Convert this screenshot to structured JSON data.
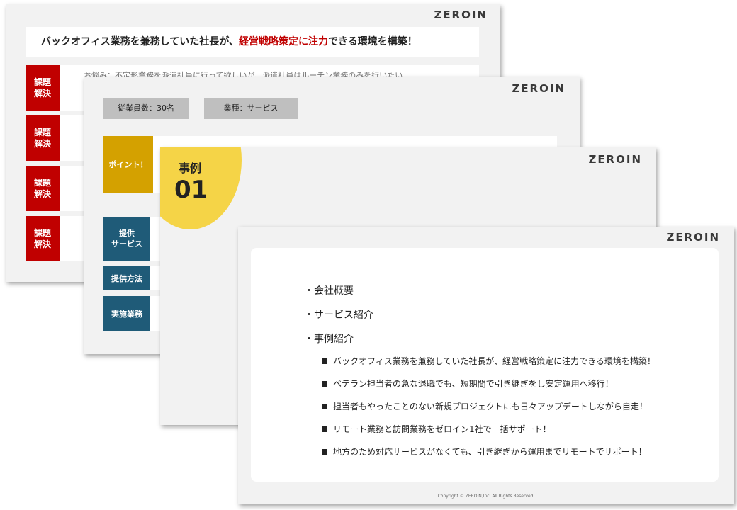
{
  "brand": "ZEROIN",
  "colors": {
    "accent_red": "#c00000",
    "accent_gold": "#d4a100",
    "accent_navy": "#1f5b78",
    "accent_yellow": "#f5d447"
  },
  "slide1": {
    "headline_pre": "バックオフィス業務を兼務していた社長が、",
    "headline_red": "経営戦略策定に注力",
    "headline_post": "できる環境を構築！",
    "issue_label_1": "課題",
    "issue_label_2": "解決",
    "partial_text": "お悩み：不定形業務を派遣社員に行って欲しいが、派遣社員はルーチン業務のみを行いたい"
  },
  "slide2": {
    "employees": "従業員数：30名",
    "industry": "業種：サービス",
    "point": "ポイント！",
    "service_1": "提供",
    "service_2": "サービス",
    "method": "提供方法",
    "work": "実施業務"
  },
  "slide3": {
    "case_label": "事例",
    "case_number": "01"
  },
  "slide4": {
    "main_items": [
      "・会社概要",
      "・サービス紹介",
      "・事例紹介"
    ],
    "sub_items": [
      "バックオフィス業務を兼務していた社長が、経営戦略策定に注力できる環境を構築！",
      "ベテラン担当者の急な退職でも、短期間で引き継ぎをし安定運用へ移行！",
      "担当者もやったことのない新規プロジェクトにも日々アップデートしながら自走！",
      "リモート業務と訪問業務をゼロイン1社で一括サポート！",
      "地方のため対応サービスがなくても、引き継ぎから運用までリモートでサポート！"
    ],
    "copyright": "Copyright © ZEROIN,Inc. All Rights Reserved."
  }
}
